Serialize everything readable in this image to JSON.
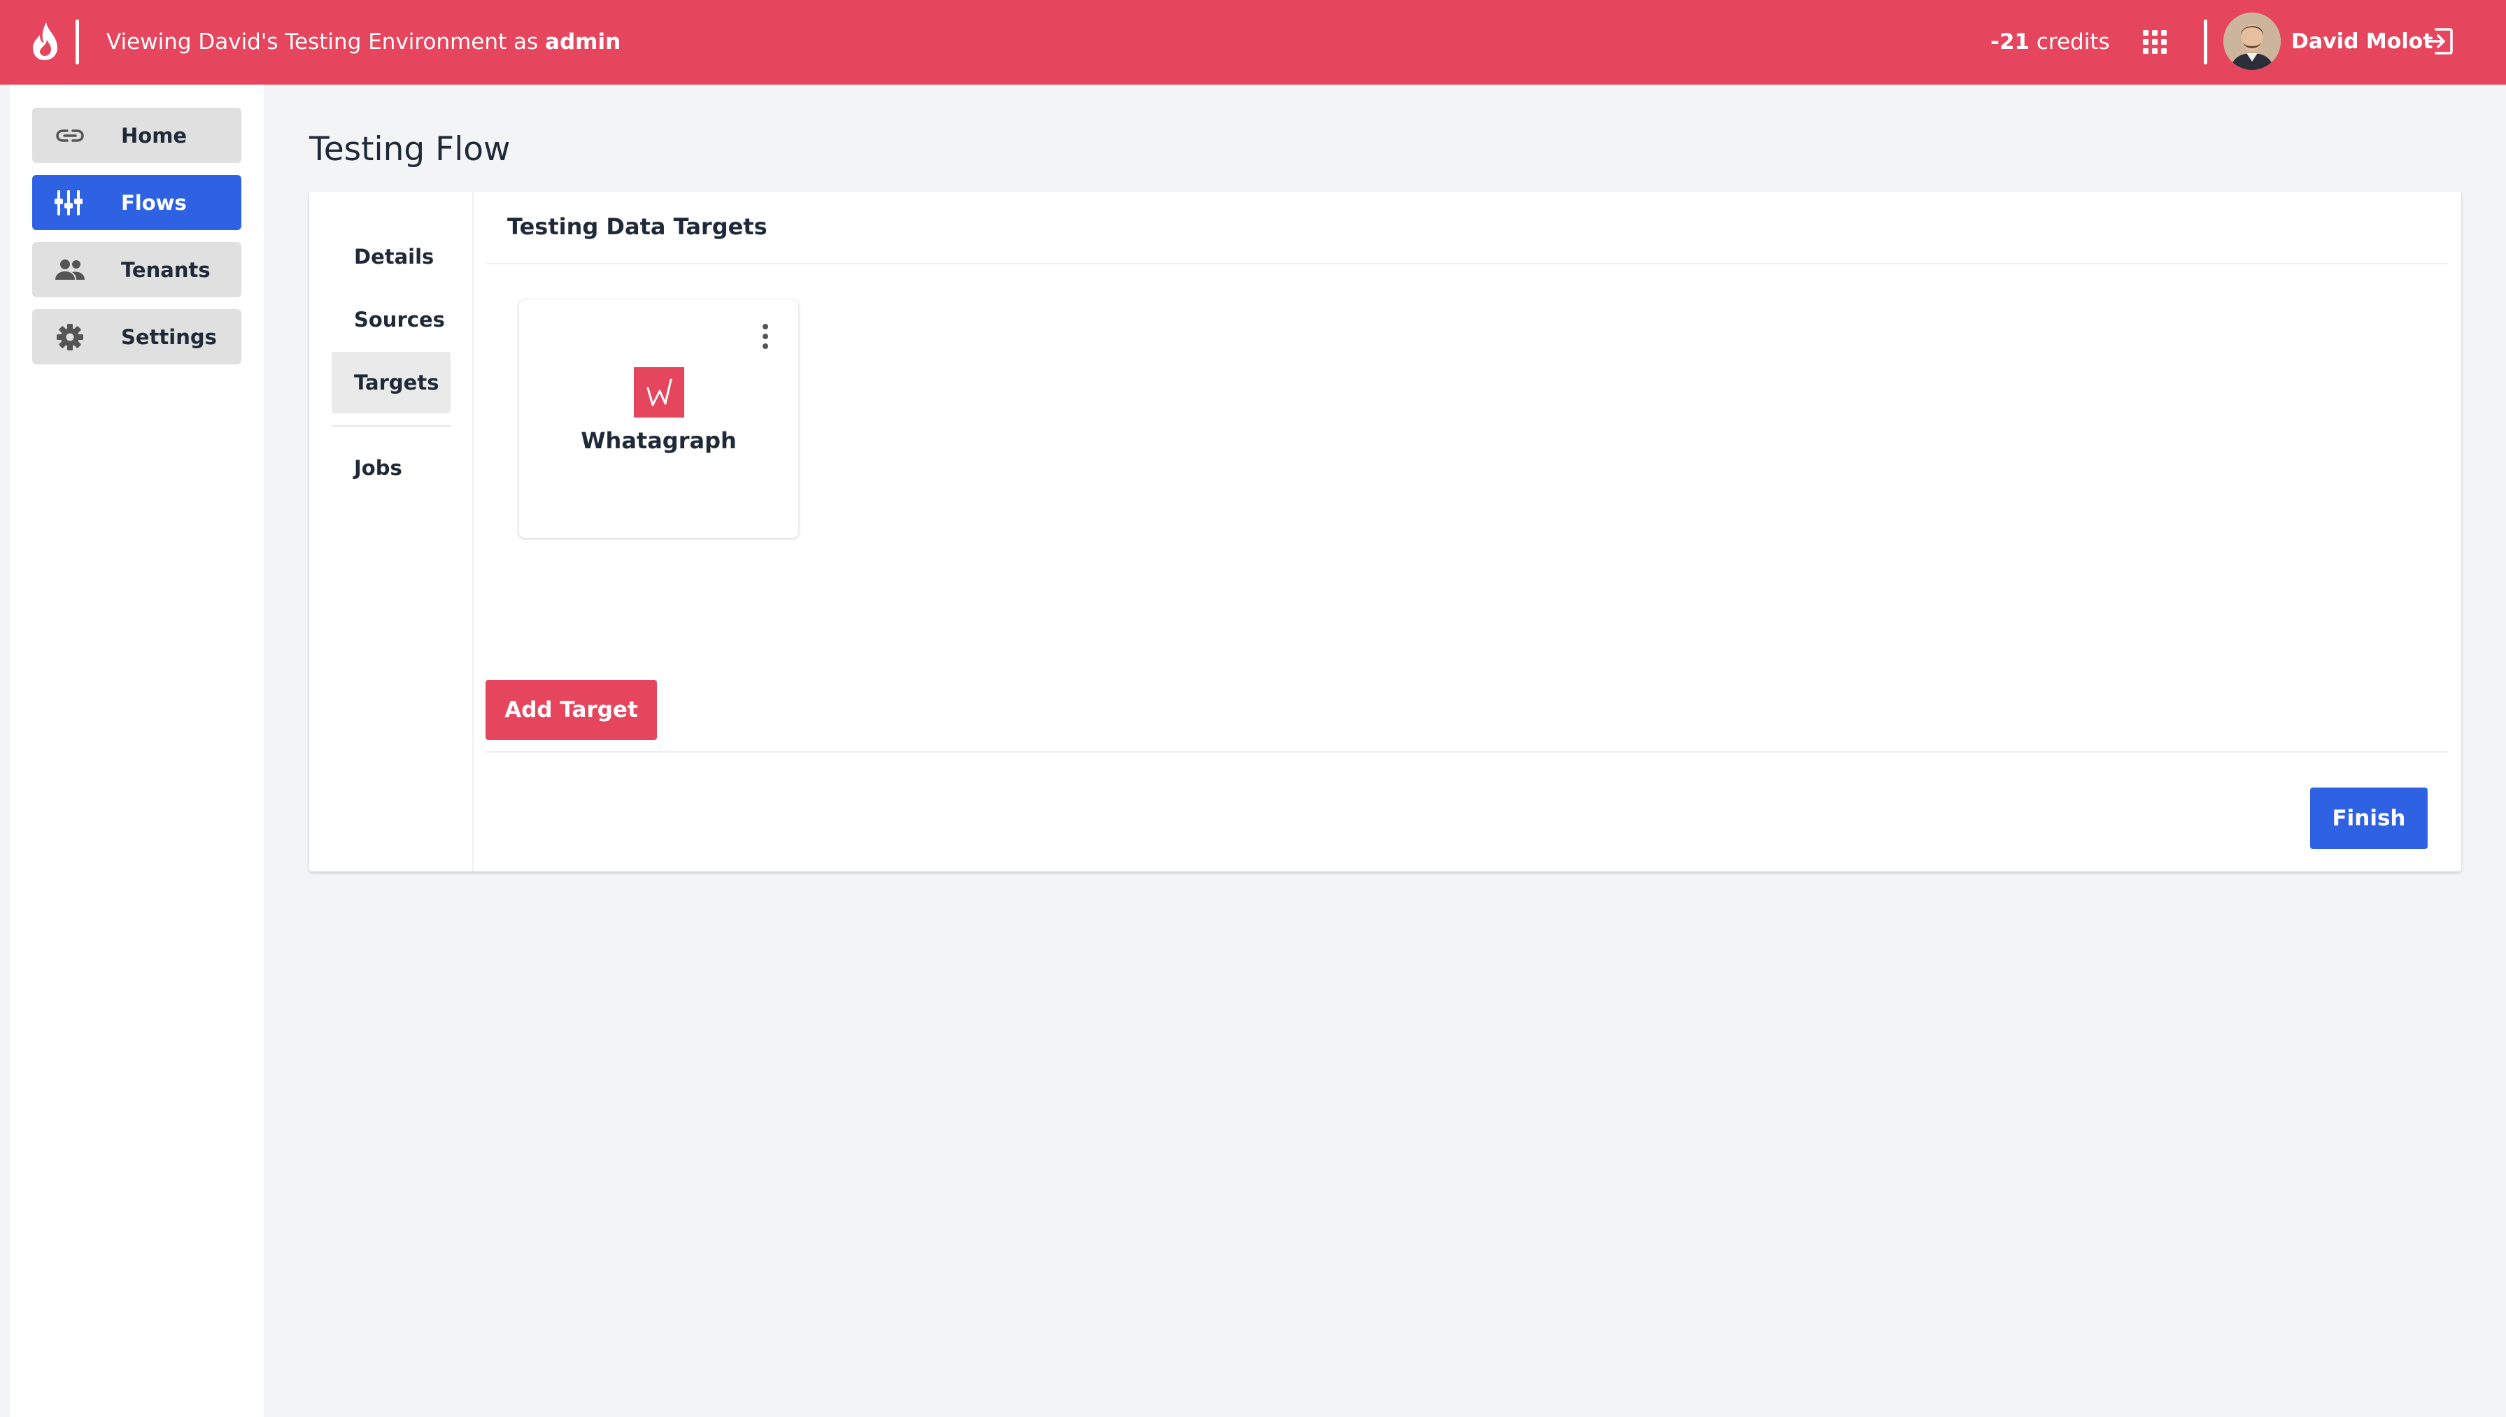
{
  "topbar": {
    "viewing_prefix": "Viewing David's Testing Environment as ",
    "viewing_role": "admin",
    "credits_value": "-21",
    "credits_label": " credits",
    "user_name": "David Molot",
    "logo_icon": "flame-icon",
    "apps_icon": "grid-icon",
    "logout_icon": "logout-icon"
  },
  "sidebar": {
    "items": [
      {
        "label": "Home",
        "icon": "link-icon",
        "active": false
      },
      {
        "label": "Flows",
        "icon": "flows-icon",
        "active": true
      },
      {
        "label": "Tenants",
        "icon": "people-icon",
        "active": false
      },
      {
        "label": "Settings",
        "icon": "gear-icon",
        "active": false
      }
    ]
  },
  "page": {
    "title": "Testing Flow"
  },
  "steps": {
    "items": [
      {
        "label": "Details",
        "active": false
      },
      {
        "label": "Sources",
        "active": false
      },
      {
        "label": "Targets",
        "active": true
      },
      {
        "label": "Jobs",
        "active": false
      }
    ]
  },
  "content": {
    "title": "Testing Data Targets",
    "targets": [
      {
        "name": "Whatagraph",
        "logo_color": "#e5455d"
      }
    ],
    "add_button": "Add Target",
    "finish_button": "Finish"
  },
  "colors": {
    "brand": "#e5455d",
    "primary": "#2f62e3",
    "background": "#f3f4f6"
  }
}
